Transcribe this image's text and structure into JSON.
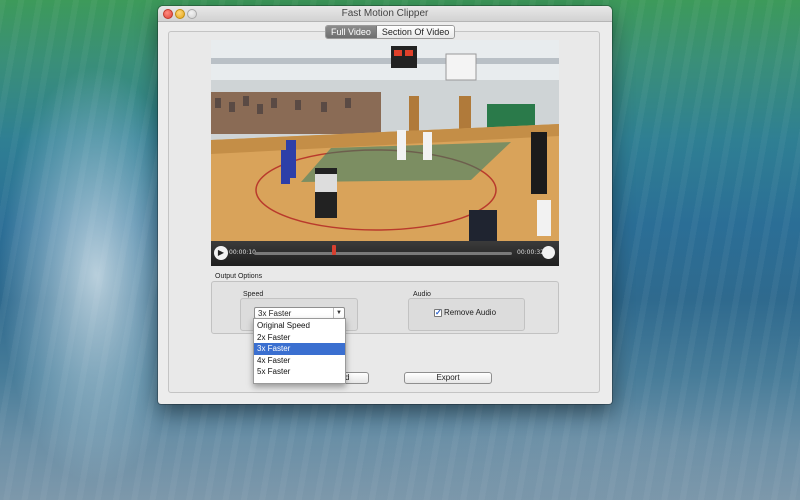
{
  "window": {
    "title": "Fast Motion Clipper"
  },
  "tabs": [
    {
      "label": "Full Video",
      "active": true
    },
    {
      "label": "Section Of Video",
      "active": false
    }
  ],
  "player": {
    "current_time": "00:00:10",
    "total_time": "00:00:32",
    "progress": 0.31
  },
  "output_options": {
    "label": "Output Options",
    "speed": {
      "label": "Speed",
      "selected": "3x Faster",
      "options": [
        "Original Speed",
        "2x Faster",
        "3x Faster",
        "4x Faster",
        "5x Faster"
      ]
    },
    "audio": {
      "label": "Audio",
      "remove_audio_label": "Remove Audio",
      "remove_audio_checked": true
    }
  },
  "buttons": {
    "upload_label": "Video Upload",
    "export_label": "Export"
  },
  "colors": {
    "selection": "#3a6fd0",
    "scrub_handle": "#d84030"
  }
}
